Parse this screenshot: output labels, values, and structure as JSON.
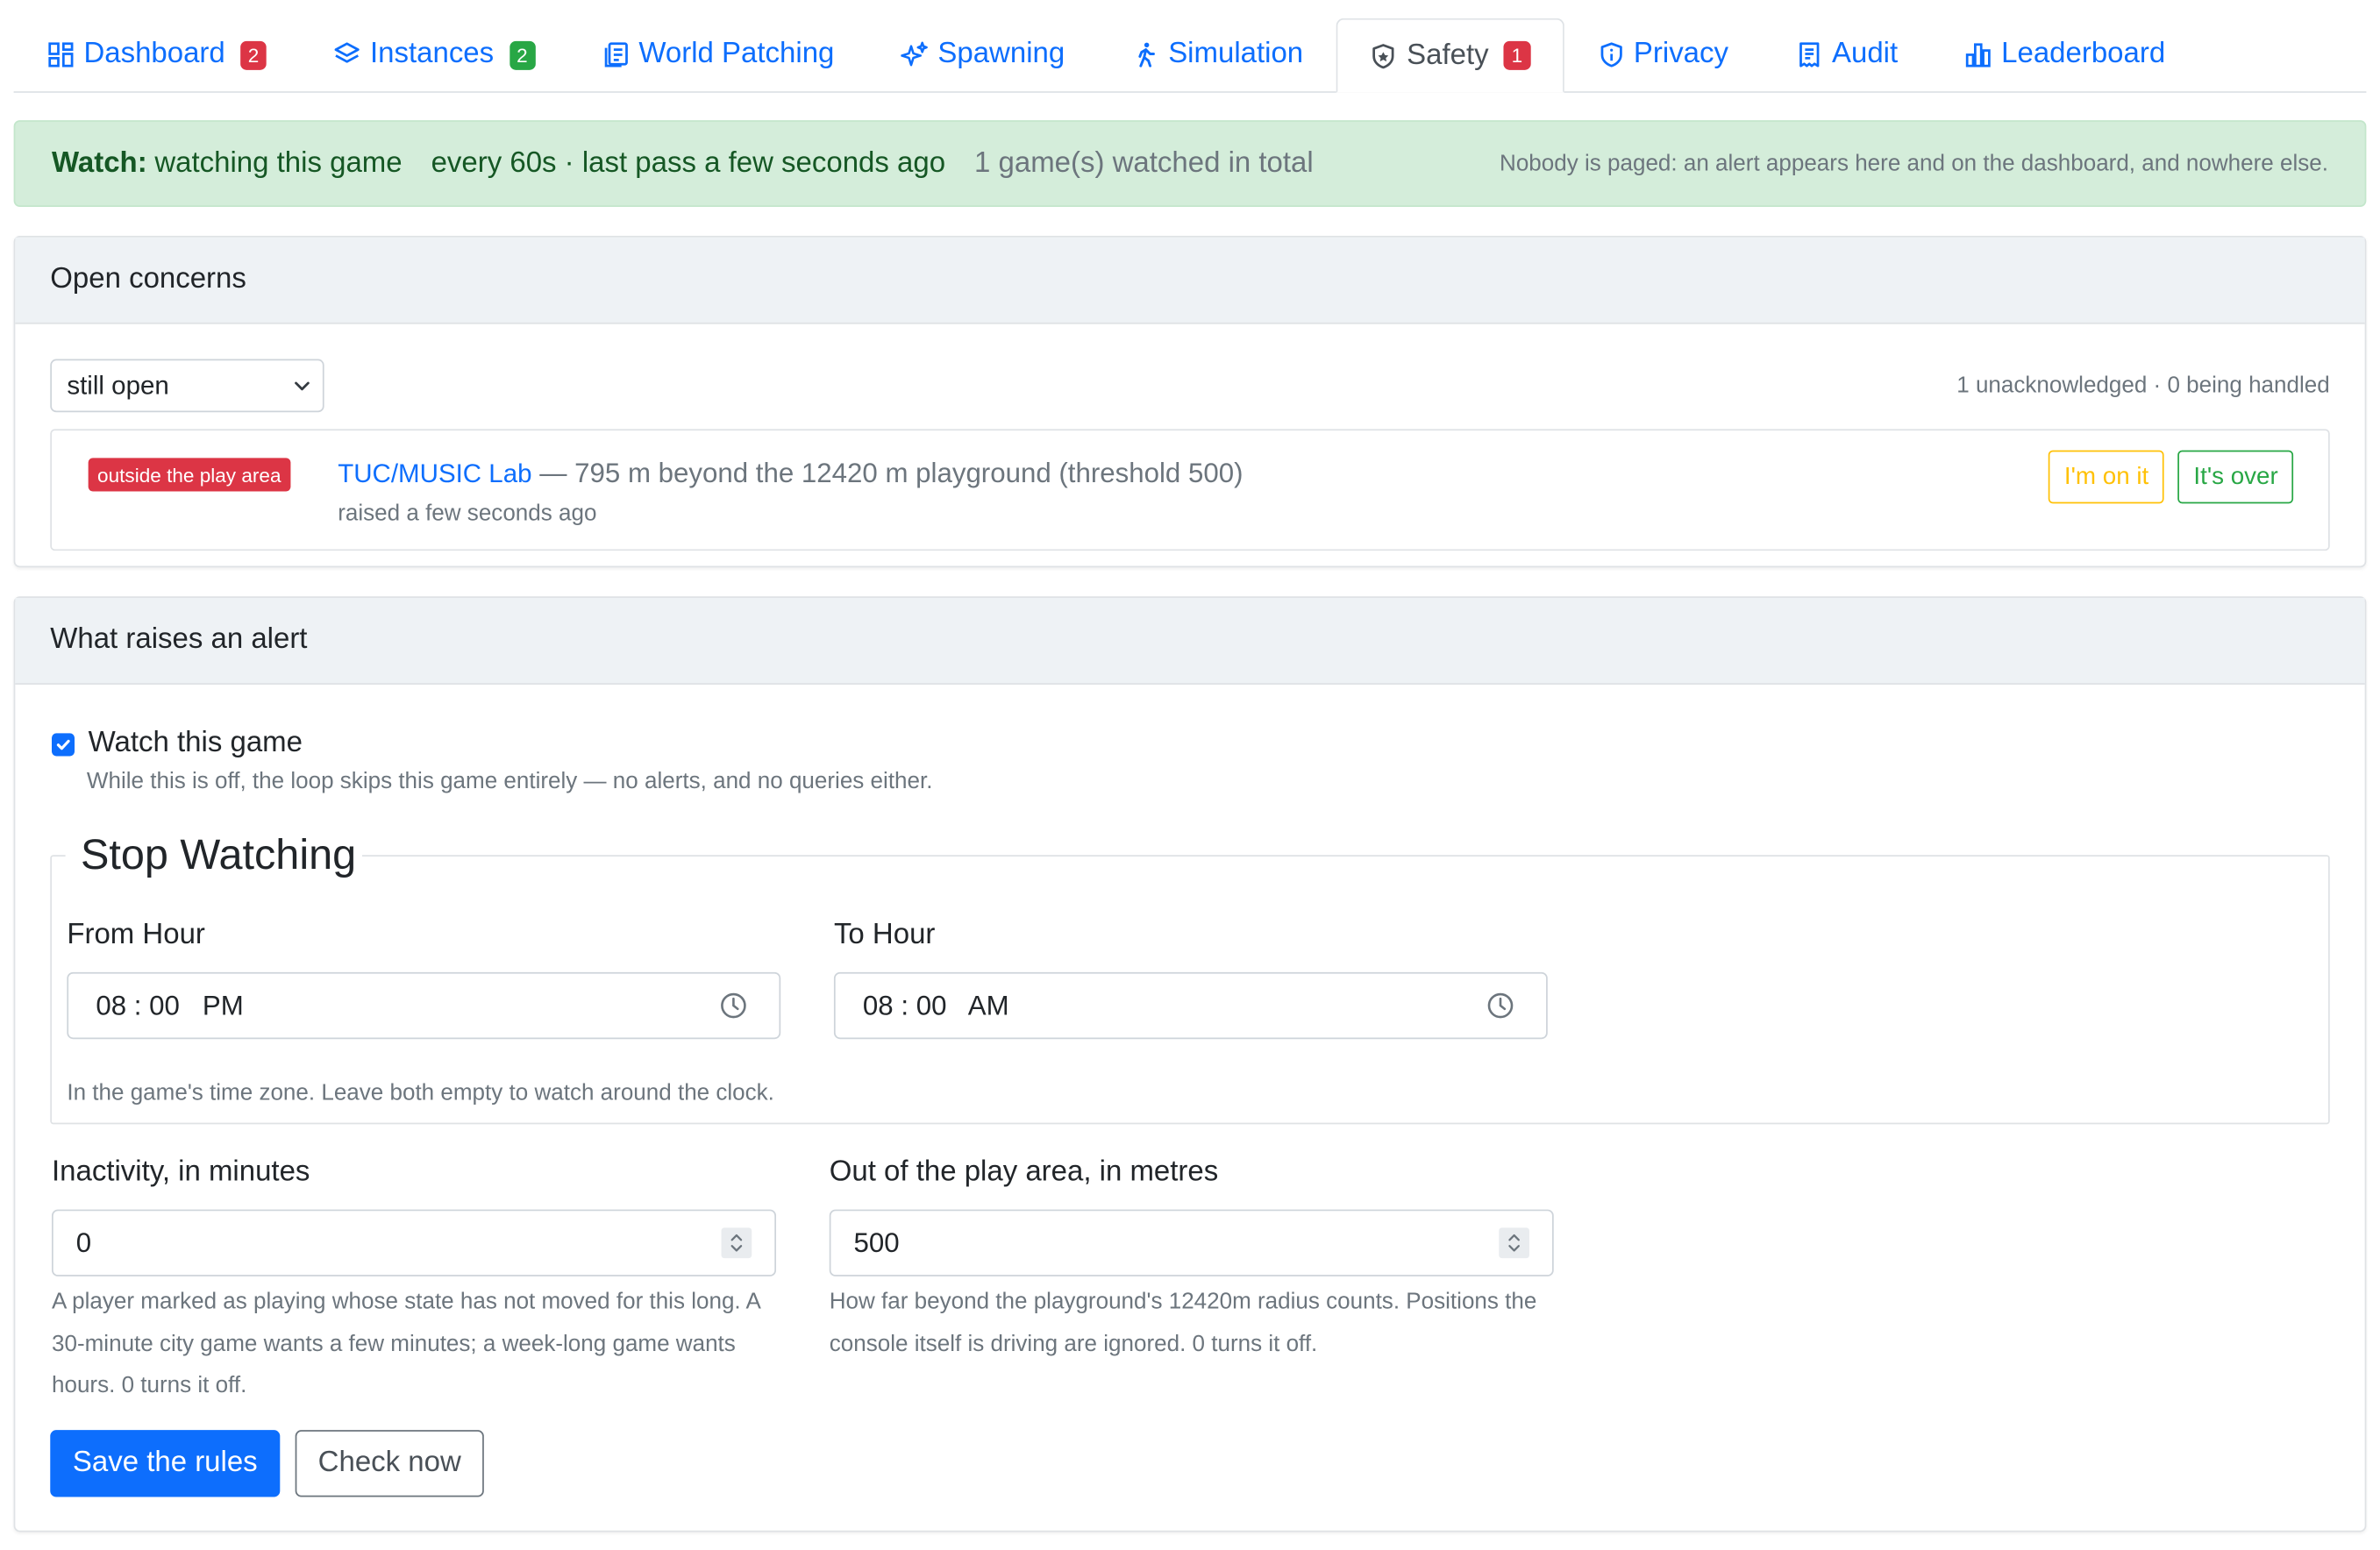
{
  "tabs": [
    {
      "label": "Dashboard",
      "icon": "dashboard-icon",
      "badge": "2",
      "badge_color": "#dc3545"
    },
    {
      "label": "Instances",
      "icon": "layers-icon",
      "badge": "2",
      "badge_color": "#28a745"
    },
    {
      "label": "World Patching",
      "icon": "document-icon"
    },
    {
      "label": "Spawning",
      "icon": "sparkles-icon"
    },
    {
      "label": "Simulation",
      "icon": "walking-person-icon"
    },
    {
      "label": "Safety",
      "icon": "shield-icon",
      "badge": "1",
      "badge_color": "#dc3545",
      "active": true
    },
    {
      "label": "Privacy",
      "icon": "shield-info-icon"
    },
    {
      "label": "Audit",
      "icon": "receipt-icon"
    },
    {
      "label": "Leaderboard",
      "icon": "bar-chart-icon"
    }
  ],
  "banner": {
    "label": "Watch:",
    "status": "watching this game",
    "interval": "every 60s · last pass a few seconds ago",
    "total": "1 game(s) watched in total",
    "note": "Nobody is paged: an alert appears here and on the dashboard, and nowhere else."
  },
  "concerns": {
    "title": "Open concerns",
    "filter_value": "still open",
    "summary": "1 unacknowledged · 0 being handled",
    "items": [
      {
        "tag": "outside the play area",
        "game": "TUC/MUSIC Lab",
        "detail": "— 795 m beyond the 12420 m playground (threshold 500)",
        "raised": "raised a few seconds ago",
        "ack_label": "I'm on it",
        "close_label": "It's over"
      }
    ]
  },
  "rules": {
    "title": "What raises an alert",
    "watch_label": "Watch this game",
    "watch_checked": true,
    "watch_help": "While this is off, the loop skips this game entirely — no alerts, and no queries either.",
    "stop_legend": "Stop Watching",
    "from_label": "From Hour",
    "from_value": "08 : 00   PM",
    "to_label": "To Hour",
    "to_value": "08 : 00   AM",
    "hours_help": "In the game's time zone. Leave both empty to watch around the clock.",
    "inactivity_label": "Inactivity, in minutes",
    "inactivity_value": "0",
    "inactivity_help": "A player marked as playing whose state has not moved for this long. A 30-minute city game wants a few minutes; a week-long game wants hours. 0 turns it off.",
    "area_label": "Out of the play area, in metres",
    "area_value": "500",
    "area_help": "How far beyond the playground's 12420m radius counts. Positions the console itself is driving are ignored. 0 turns it off.",
    "save_label": "Save the rules",
    "check_label": "Check now"
  },
  "colors": {
    "primary": "#0d6efd",
    "danger": "#dc3545",
    "success": "#28a745",
    "warning": "#ffc107",
    "banner_bg": "#d4edda"
  }
}
